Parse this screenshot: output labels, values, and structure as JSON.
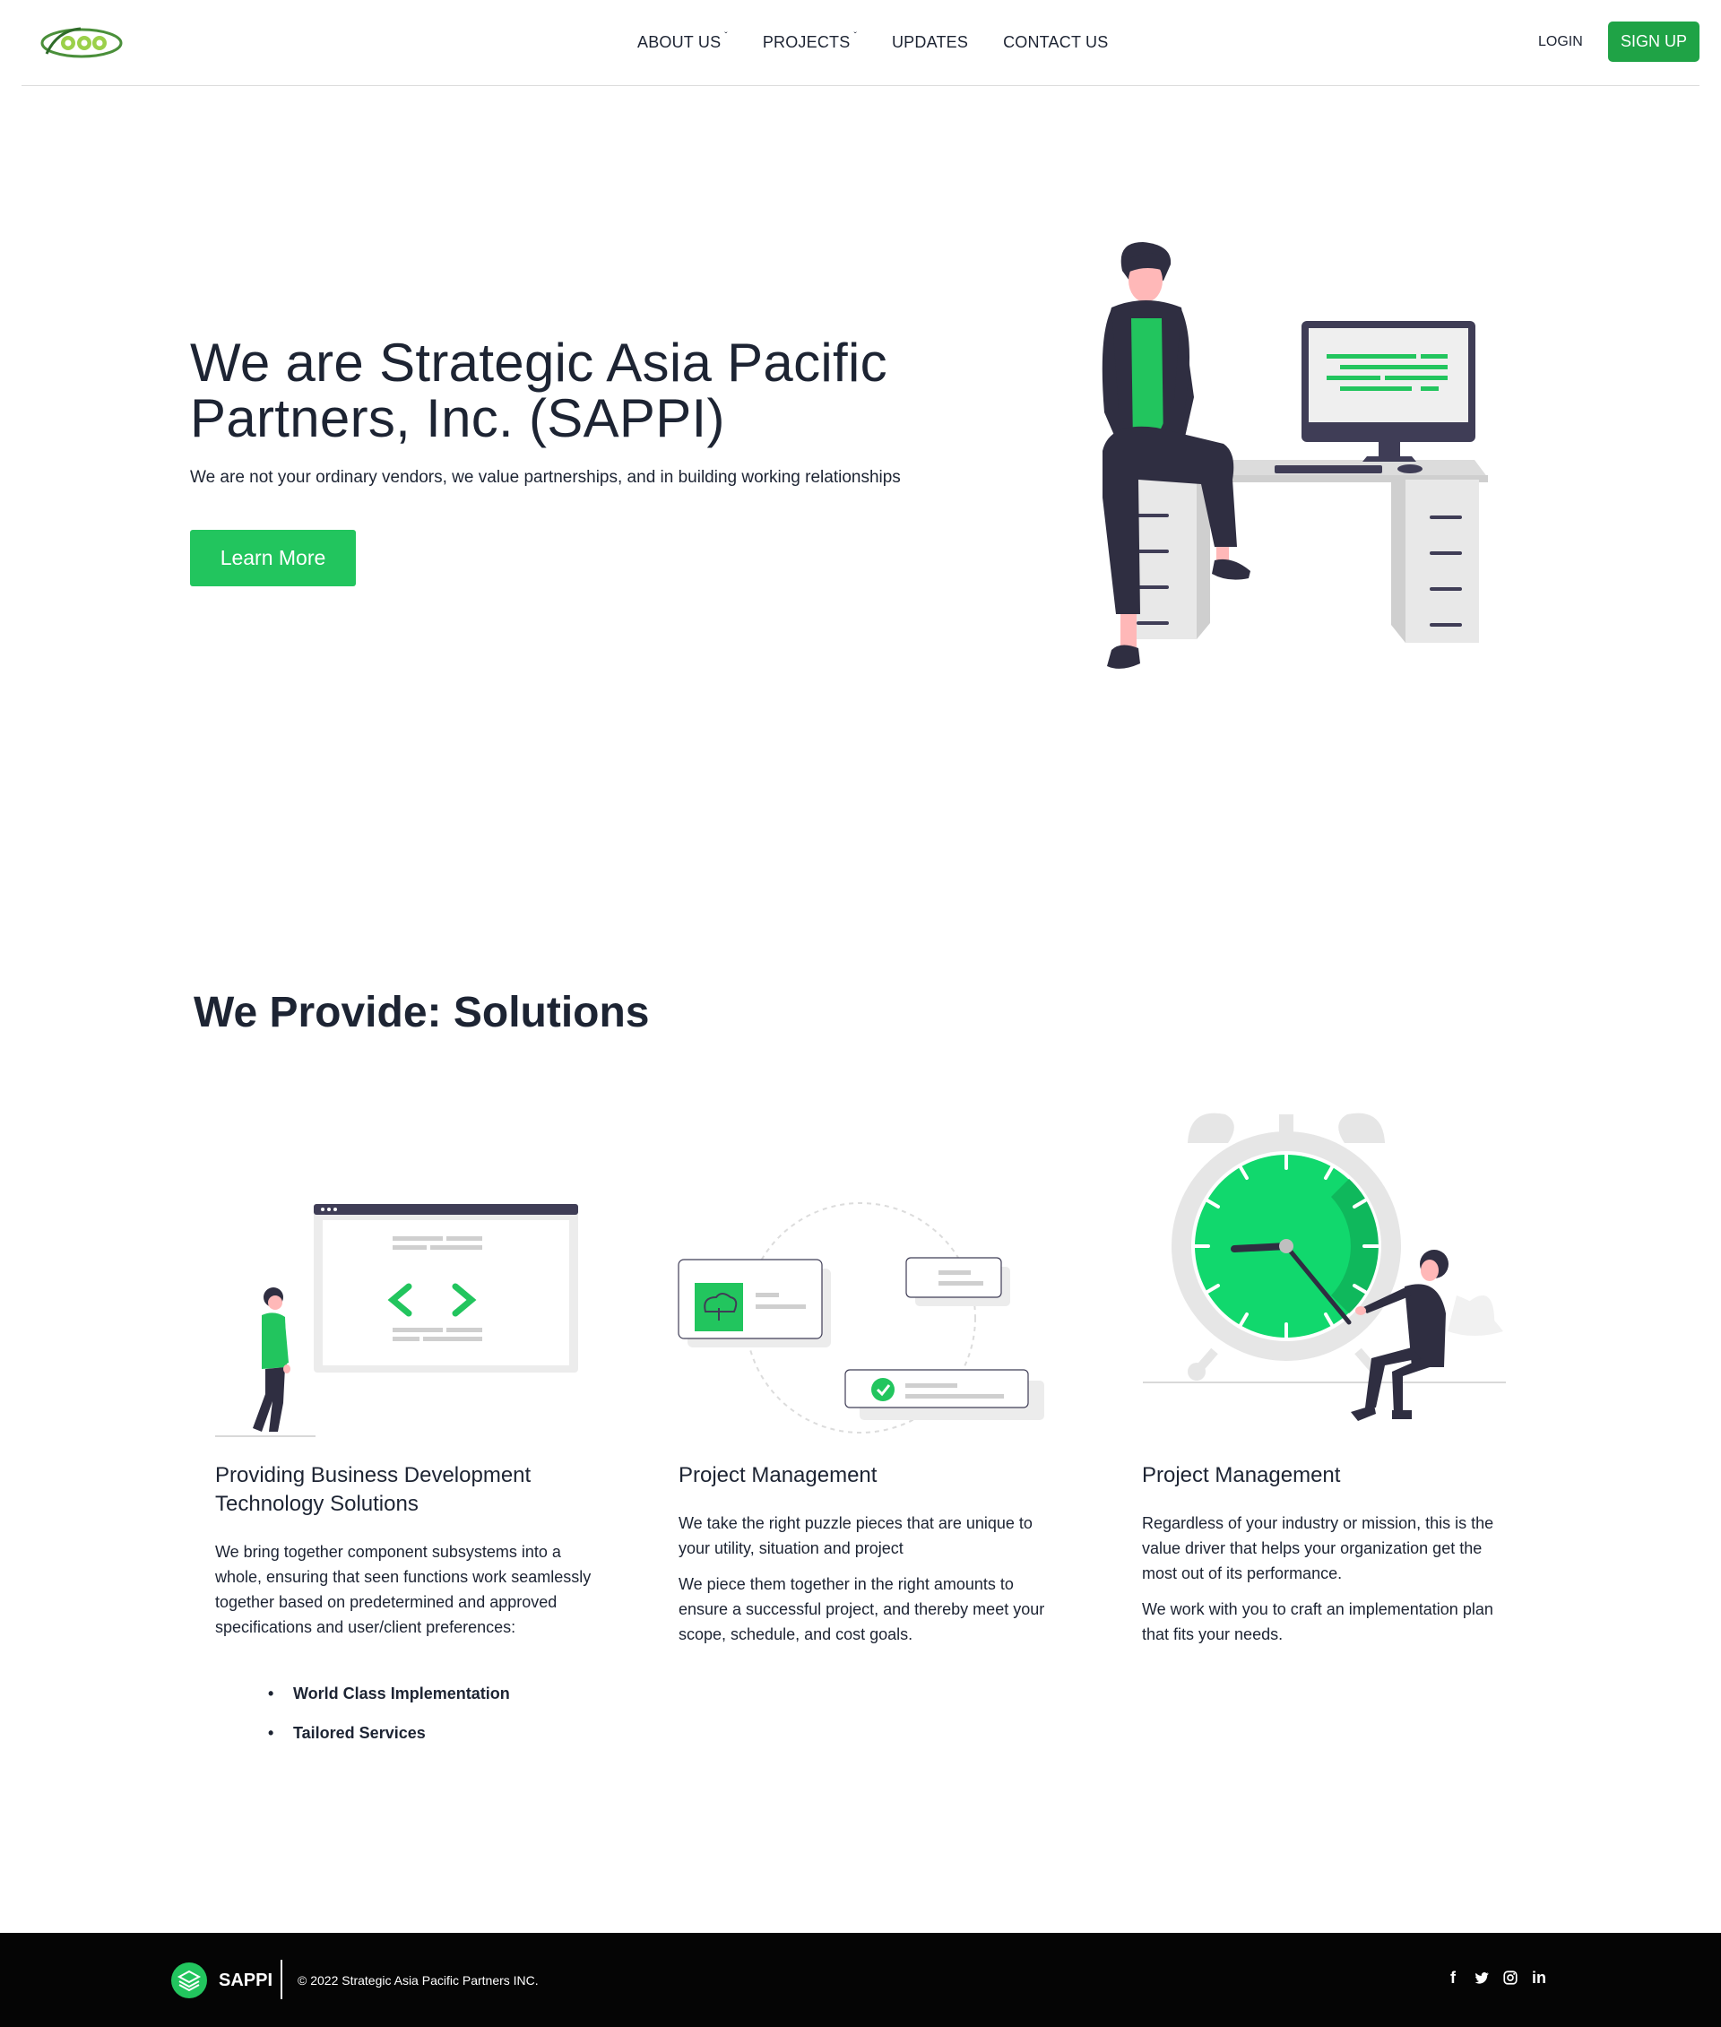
{
  "nav": {
    "logo_text": "sappi",
    "items": [
      {
        "label": "ABOUT US",
        "dropdown": true
      },
      {
        "label": "PROJECTS",
        "dropdown": true
      },
      {
        "label": "UPDATES",
        "dropdown": false
      },
      {
        "label": "CONTACT US",
        "dropdown": false
      }
    ],
    "login": "LOGIN",
    "signup": "SIGN UP"
  },
  "hero": {
    "title": "We are Strategic Asia Pacific Partners, Inc. (SAPPI)",
    "subtitle": "We are not your ordinary vendors, we value partnerships, and in building working relationships",
    "cta": "Learn More"
  },
  "solutions": {
    "title": "We Provide: Solutions",
    "columns": [
      {
        "title": "Providing Business Development Technology Solutions",
        "paragraphs": [
          "We bring together component subsystems into a whole, ensuring that seen functions work seamlessly together based on predetermined and approved specifications and user/client preferences:"
        ],
        "bullets": [
          "World Class Implementation",
          "Tailored Services"
        ]
      },
      {
        "title": "Project Management",
        "paragraphs": [
          "We take the right puzzle pieces that are unique to your utility, situation and project",
          "We piece them together in the right amounts to ensure a successful project, and thereby meet your scope, schedule, and cost goals."
        ]
      },
      {
        "title": "Project Management",
        "paragraphs": [
          "Regardless of your industry or mission, this is the value driver that helps your organization get the most out of its performance.",
          "We work with you to craft an implementation plan that fits your needs."
        ]
      }
    ]
  },
  "footer": {
    "brand": "SAPPI",
    "copyright": "© 2022 Strategic Asia Pacific Partners INC.",
    "social": [
      "facebook-icon",
      "twitter-icon",
      "instagram-icon",
      "linkedin-icon"
    ]
  },
  "colors": {
    "accent": "#22c55e",
    "signup": "#1fa346",
    "text": "#1d2433",
    "footer": "#050505"
  }
}
